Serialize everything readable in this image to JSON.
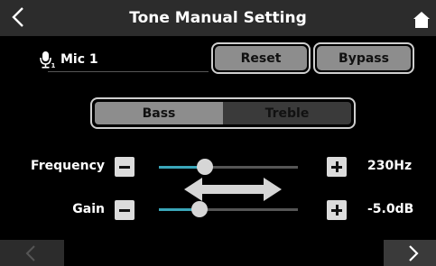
{
  "header": {
    "title": "Tone Manual Setting"
  },
  "input": {
    "mic_label": "Mic 1",
    "mic_subscript": "1"
  },
  "buttons": {
    "reset": "Reset",
    "bypass": "Bypass"
  },
  "tabs": {
    "bass": "Bass",
    "treble": "Treble",
    "selected": "Bass"
  },
  "frequency": {
    "label": "Frequency",
    "value": "230Hz",
    "level": 0.33
  },
  "gain": {
    "label": "Gain",
    "value": "-5.0dB",
    "level": 0.29
  },
  "colors": {
    "accent": "#3aa6b9",
    "button": "#8d8d8d",
    "header": "#2c2c2c"
  },
  "icons": {
    "back": "chevron-left-icon",
    "home": "home-icon",
    "mic": "microphone-icon",
    "minus": "minus-icon",
    "plus": "plus-icon",
    "swap": "double-arrow-icon",
    "prev": "chevron-left-icon",
    "next": "chevron-right-icon"
  }
}
